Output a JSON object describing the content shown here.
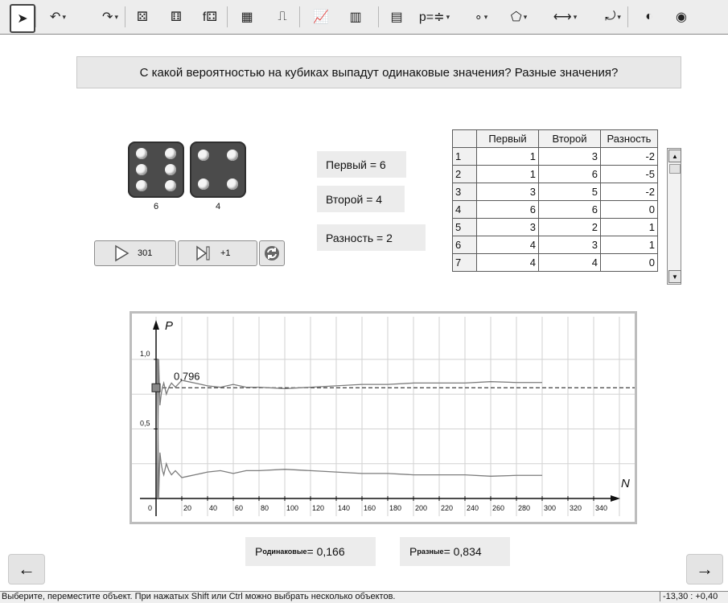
{
  "toolbar": {
    "items": [
      {
        "name": "move-tool-icon",
        "glyph": "➤"
      },
      {
        "name": "undo-icon",
        "glyph": "↶"
      },
      {
        "name": "redo-icon",
        "glyph": "↷"
      },
      {
        "name": "dice-icon",
        "glyph": "⚄"
      },
      {
        "name": "dice-roll-icon",
        "glyph": "⚅"
      },
      {
        "name": "dice-function-icon",
        "glyph": "f⚃"
      },
      {
        "name": "spreadsheet-icon",
        "glyph": "▦"
      },
      {
        "name": "step-chart-icon",
        "glyph": "⎍"
      },
      {
        "name": "line-chart-icon",
        "glyph": "📈"
      },
      {
        "name": "histogram-icon",
        "glyph": "▥"
      },
      {
        "name": "calculator-icon",
        "glyph": "▤"
      },
      {
        "name": "probability-icon",
        "glyph": "p=≑"
      },
      {
        "name": "point-icon",
        "glyph": "∘"
      },
      {
        "name": "polygon-icon",
        "glyph": "⬠"
      },
      {
        "name": "distance-icon",
        "glyph": "⟷"
      },
      {
        "name": "transform-icon",
        "glyph": "⤾"
      },
      {
        "name": "show-hide-icon",
        "glyph": "◐"
      },
      {
        "name": "eye-icon",
        "glyph": "◉"
      }
    ]
  },
  "question": "С какой вероятностью на кубиках выпадут одинаковые значения? Разные значения?",
  "dice": {
    "first_value": "6",
    "second_value": "4"
  },
  "buttons": {
    "run_label": "301",
    "step_label": "+1"
  },
  "info": {
    "first": "Первый = 6",
    "second": "Второй = 4",
    "diff": "Разность = 2"
  },
  "table": {
    "headers": [
      "Первый",
      "Второй",
      "Разность"
    ],
    "rows": [
      {
        "n": "1",
        "a": "1",
        "b": "3",
        "c": "-2"
      },
      {
        "n": "2",
        "a": "1",
        "b": "6",
        "c": "-5"
      },
      {
        "n": "3",
        "a": "3",
        "b": "5",
        "c": "-2"
      },
      {
        "n": "4",
        "a": "6",
        "b": "6",
        "c": "0"
      },
      {
        "n": "5",
        "a": "3",
        "b": "2",
        "c": "1"
      },
      {
        "n": "6",
        "a": "4",
        "b": "3",
        "c": "1"
      },
      {
        "n": "7",
        "a": "4",
        "b": "4",
        "c": "0"
      }
    ]
  },
  "graph": {
    "y_axis_label": "P",
    "x_axis_label": "N",
    "y_ticks": [
      "1,0",
      "0,5"
    ],
    "x_ticks": [
      "0",
      "20",
      "40",
      "60",
      "80",
      "100",
      "120",
      "140",
      "160",
      "180",
      "200",
      "220",
      "240",
      "260",
      "280",
      "300",
      "320",
      "340"
    ],
    "point_label": "0,796"
  },
  "chart_data": {
    "type": "line",
    "xlabel": "N",
    "ylabel": "P",
    "xlim": [
      0,
      350
    ],
    "ylim": [
      0,
      1.05
    ],
    "reference_line": 0.796,
    "series": [
      {
        "x": [
          1,
          2,
          3,
          4,
          5,
          6,
          8,
          10,
          12,
          15,
          20,
          25,
          30,
          40,
          50,
          60,
          70,
          80,
          100,
          120,
          140,
          160,
          180,
          200,
          220,
          240,
          260,
          280,
          300
        ],
        "y": [
          0,
          1,
          0.67,
          0.75,
          0.8,
          0.83,
          0.75,
          0.8,
          0.83,
          0.8,
          0.85,
          0.84,
          0.83,
          0.81,
          0.8,
          0.82,
          0.8,
          0.8,
          0.79,
          0.8,
          0.81,
          0.82,
          0.82,
          0.83,
          0.83,
          0.83,
          0.84,
          0.834,
          0.834
        ]
      },
      {
        "x": [
          1,
          2,
          3,
          4,
          5,
          6,
          8,
          10,
          12,
          15,
          20,
          25,
          30,
          40,
          50,
          60,
          70,
          80,
          100,
          120,
          140,
          160,
          180,
          200,
          220,
          240,
          260,
          280,
          300
        ],
        "y": [
          1,
          0,
          0.33,
          0.25,
          0.2,
          0.17,
          0.25,
          0.2,
          0.17,
          0.2,
          0.15,
          0.16,
          0.17,
          0.19,
          0.2,
          0.18,
          0.2,
          0.2,
          0.21,
          0.2,
          0.19,
          0.18,
          0.18,
          0.17,
          0.17,
          0.17,
          0.16,
          0.166,
          0.166
        ]
      }
    ]
  },
  "results": {
    "same_label": "одинаковые",
    "same_value": " = 0,166",
    "diff_label": "разные",
    "diff_value": " = 0,834"
  },
  "status": {
    "message": "Выберите, переместите объект. При нажатых Shift или Ctrl можно выбрать несколько объектов.",
    "coords": "-13,30 : +0,40"
  }
}
